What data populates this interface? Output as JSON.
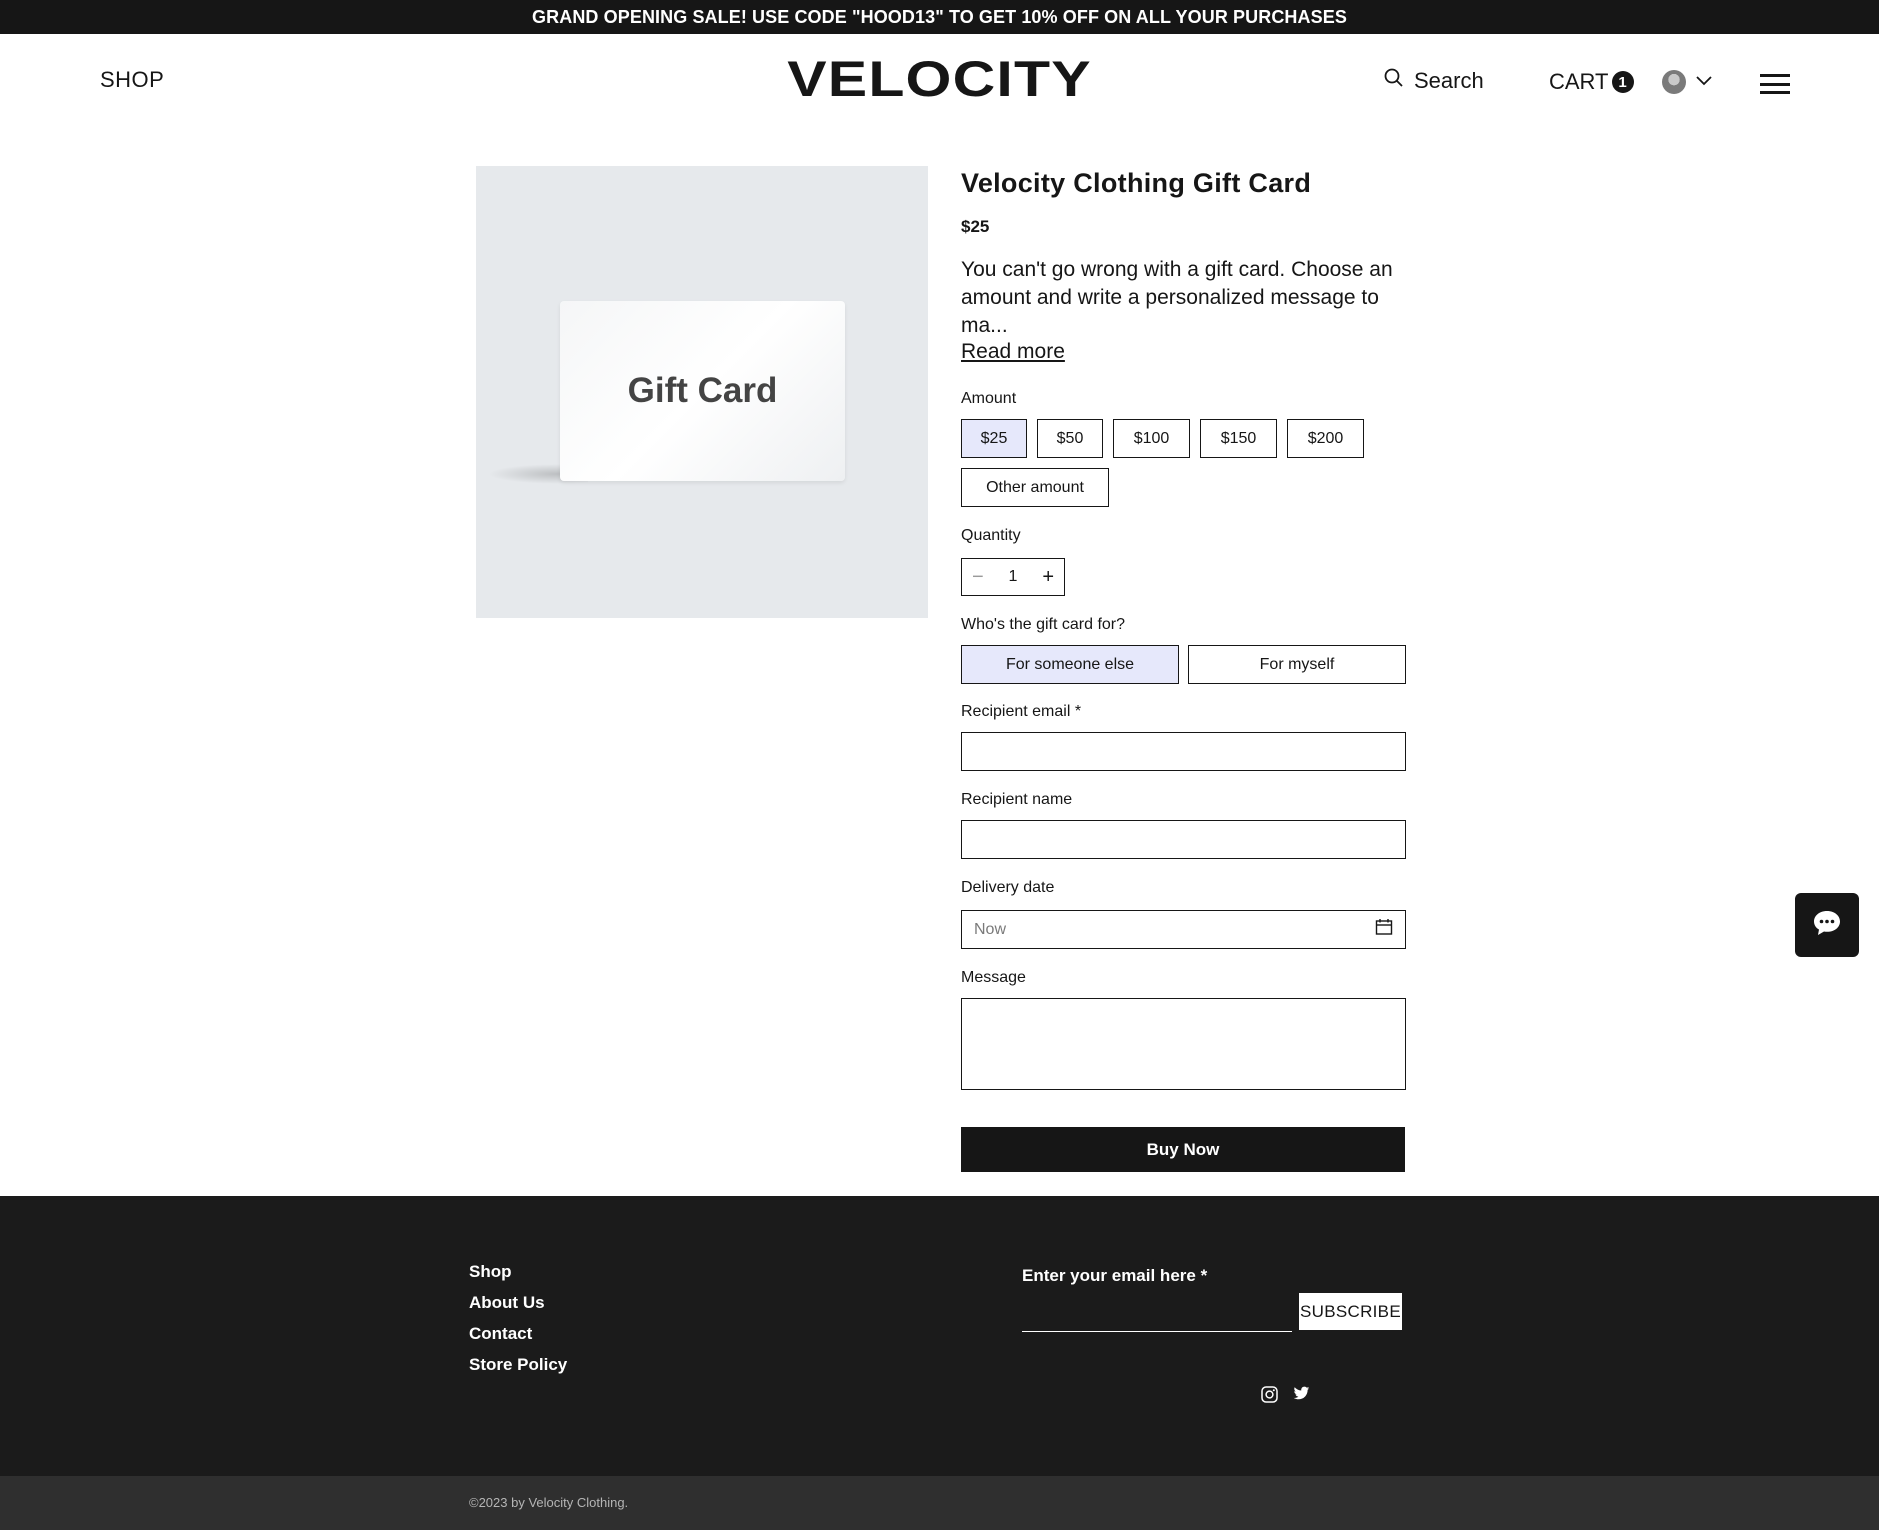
{
  "announcement": "GRAND OPENING SALE! USE CODE \"HOOD13\" TO GET 10% OFF ON ALL YOUR PURCHASES",
  "header": {
    "shop_label": "SHOP",
    "logo": "VELOCITY",
    "search_label": "Search",
    "cart_label": "CART",
    "cart_count": "1",
    "icons": {
      "search": "search-icon",
      "account": "avatar",
      "chevron": "chevron-down-icon",
      "menu": "hamburger-menu-icon"
    }
  },
  "product": {
    "image_text": "Gift Card",
    "title": "Velocity Clothing Gift Card",
    "price": "$25",
    "description": "You can't go wrong with a gift card. Choose an amount and write a personalized message to ma...",
    "read_more": "Read more"
  },
  "form": {
    "amount_label": "Amount",
    "amounts": [
      "$25",
      "$50",
      "$100",
      "$150",
      "$200"
    ],
    "selected_amount": "$25",
    "other_amount": "Other amount",
    "quantity_label": "Quantity",
    "quantity_value": "1",
    "recipient_question": "Who's the gift card for?",
    "recipient_options": [
      "For someone else",
      "For myself"
    ],
    "selected_recipient": "For someone else",
    "recipient_email_label": "Recipient email *",
    "recipient_name_label": "Recipient name",
    "delivery_date_label": "Delivery date",
    "delivery_date_value": "Now",
    "message_label": "Message",
    "buy_label": "Buy Now"
  },
  "footer": {
    "links": [
      "Shop",
      "About Us",
      "Contact",
      "Store Policy"
    ],
    "email_label": "Enter your email here *",
    "subscribe_label": "SUBSCRIBE",
    "social_icons": [
      "instagram-icon",
      "twitter-icon"
    ],
    "copyright": "©2023 by Velocity Clothing."
  },
  "colors": {
    "dark": "#161616",
    "selected_option": "#e6e8fb",
    "footer_bg": "#1b1b1b",
    "copyright_bg": "#2f2f2f",
    "image_bg": "#e6e9ec"
  }
}
